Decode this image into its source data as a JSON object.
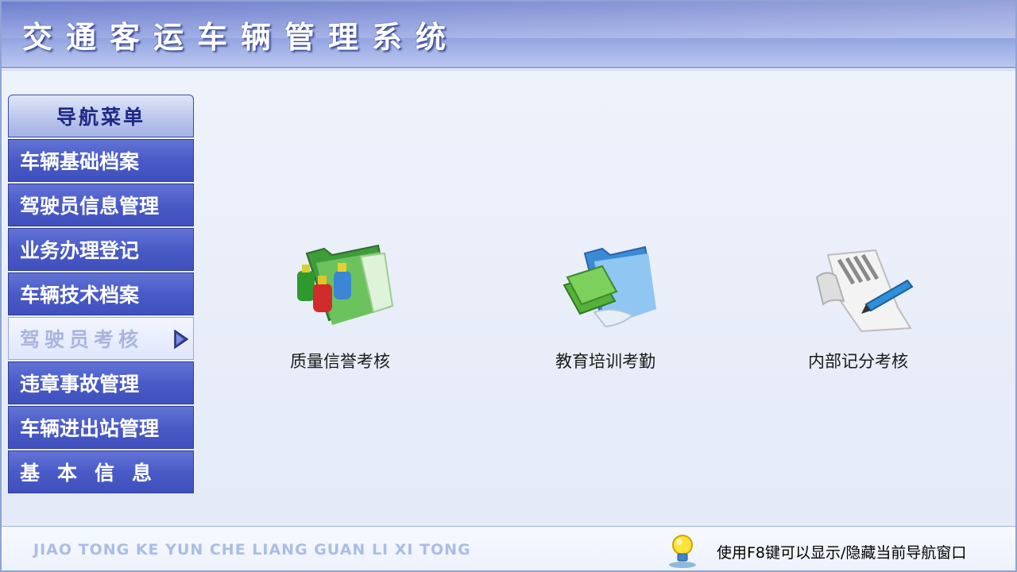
{
  "header": {
    "title": "交通客运车辆管理系统"
  },
  "sidebar": {
    "title": "导航菜单",
    "items": [
      {
        "label": "车辆基础档案"
      },
      {
        "label": "驾驶员信息管理"
      },
      {
        "label": "业务办理登记"
      },
      {
        "label": "车辆技术档案"
      },
      {
        "label": "驾驶员考核",
        "active": true
      },
      {
        "label": "违章事故管理"
      },
      {
        "label": "车辆进出站管理"
      },
      {
        "label": "基本信息"
      }
    ]
  },
  "main": {
    "tiles": [
      {
        "label": "质量信誉考核",
        "icon": "folder-bottles-icon"
      },
      {
        "label": "教育培训考勤",
        "icon": "folder-books-icon"
      },
      {
        "label": "内部记分考核",
        "icon": "paper-pen-icon"
      }
    ]
  },
  "footer": {
    "pinyin": "JIAO TONG KE YUN CHE LIANG GUAN LI XI TONG",
    "hint": "使用F8键可以显示/隐藏当前导航窗口",
    "hint_icon": "lightbulb-icon"
  },
  "colors": {
    "header_blue": "#6b7cd0",
    "nav_blue": "#4a5bc7",
    "nav_header_text": "#1e2a85",
    "active_bg": "#eef2ff"
  }
}
